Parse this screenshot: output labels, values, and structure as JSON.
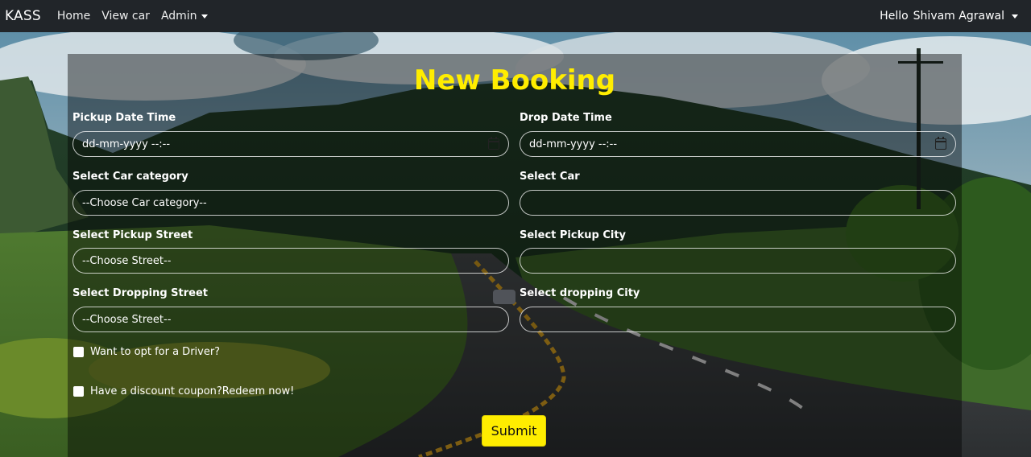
{
  "navbar": {
    "brand": "KASS",
    "links": [
      "Home",
      "View car",
      "Admin"
    ],
    "greeting": "Hello",
    "user_name": "Shivam Agrawal"
  },
  "form": {
    "title": "New Booking",
    "pickup_datetime": {
      "label": "Pickup Date Time",
      "value": "dd-mm-yyyy --:--"
    },
    "drop_datetime": {
      "label": "Drop Date Time",
      "value": "dd-mm-yyyy --:--"
    },
    "car_category": {
      "label": "Select Car category",
      "value": "--Choose Car category--"
    },
    "car": {
      "label": "Select Car",
      "value": ""
    },
    "pickup_street": {
      "label": "Select Pickup Street",
      "value": "--Choose Street--"
    },
    "pickup_city": {
      "label": "Select Pickup City",
      "value": ""
    },
    "dropping_street": {
      "label": "Select Dropping Street",
      "value": "--Choose Street--"
    },
    "dropping_city": {
      "label": "Select dropping City",
      "value": ""
    },
    "driver_option": "Want to opt for a Driver?",
    "coupon_option": "Have a discount coupon?Redeem now!",
    "submit_label": "Submit"
  },
  "colors": {
    "navbar_bg": "#212529",
    "accent_yellow": "#ffed00"
  }
}
